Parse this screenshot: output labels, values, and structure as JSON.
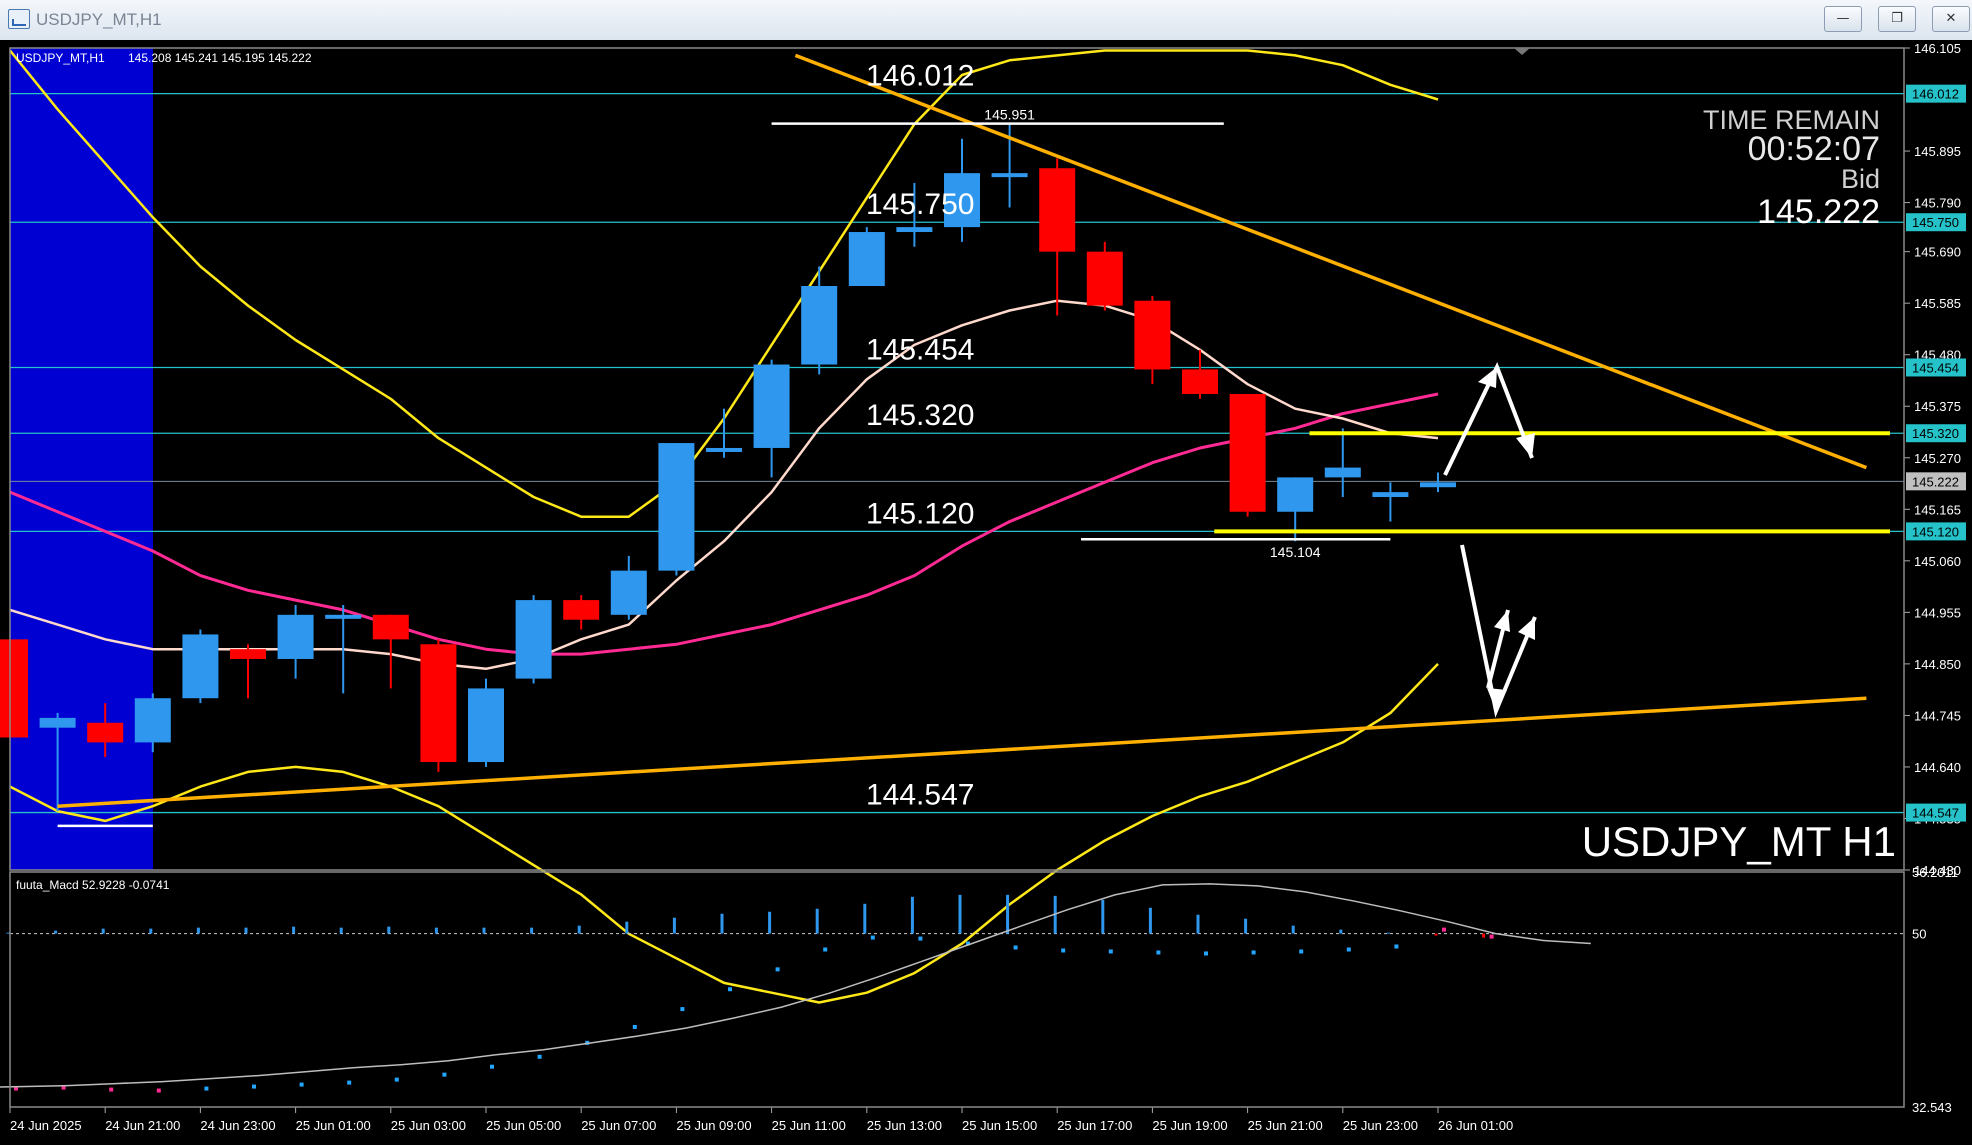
{
  "window": {
    "title": "USDJPY_MT,H1",
    "minimize_icon": "minimize-icon",
    "restore_icon": "restore-icon",
    "close_icon": "close-icon"
  },
  "header": {
    "symbol": "USDJPY_MT,H1",
    "ohlc": "145.208 145.241 145.195 145.222"
  },
  "watermark": "USDJPY_MT H1",
  "info_panel": {
    "time_remain_label": "TIME REMAIN",
    "time_remain": "00:52:07",
    "bid_label": "Bid",
    "bid": "145.222"
  },
  "colors": {
    "bull": "#2f98ee",
    "bear": "#ff0000",
    "level": "#25c3c9",
    "trend": "#ffb000",
    "band": "#ffe818",
    "ma_pink": "#ff2a93",
    "ma_white": "#ffd9cc",
    "session": "#0000d2"
  },
  "chart_data": [
    {
      "type": "candlestick",
      "symbol": "USDJPY_MT",
      "timeframe": "H1",
      "y_ticks": [
        "146.105",
        "145.895",
        "145.790",
        "145.690",
        "145.585",
        "145.480",
        "145.375",
        "145.270",
        "145.165",
        "145.060",
        "144.955",
        "144.850",
        "144.745",
        "144.640",
        "144.535",
        "144.430"
      ],
      "ylim": [
        144.43,
        146.105
      ],
      "x_tick_labels": [
        "24 Jun 2025",
        "24 Jun 21:00",
        "24 Jun 23:00",
        "25 Jun 01:00",
        "25 Jun 03:00",
        "25 Jun 05:00",
        "25 Jun 07:00",
        "25 Jun 09:00",
        "25 Jun 11:00",
        "25 Jun 13:00",
        "25 Jun 15:00",
        "25 Jun 17:00",
        "25 Jun 19:00",
        "25 Jun 21:00",
        "25 Jun 23:00",
        "26 Jun 01:00"
      ],
      "candles": [
        {
          "o": 144.9,
          "h": 144.9,
          "l": 144.7,
          "c": 144.7
        },
        {
          "o": 144.72,
          "h": 144.75,
          "l": 144.55,
          "c": 144.74
        },
        {
          "o": 144.73,
          "h": 144.77,
          "l": 144.66,
          "c": 144.69
        },
        {
          "o": 144.69,
          "h": 144.79,
          "l": 144.67,
          "c": 144.78
        },
        {
          "o": 144.78,
          "h": 144.92,
          "l": 144.77,
          "c": 144.91
        },
        {
          "o": 144.88,
          "h": 144.89,
          "l": 144.78,
          "c": 144.86
        },
        {
          "o": 144.86,
          "h": 144.97,
          "l": 144.82,
          "c": 144.95
        },
        {
          "o": 144.95,
          "h": 144.97,
          "l": 144.79,
          "c": 144.95
        },
        {
          "o": 144.95,
          "h": 144.95,
          "l": 144.8,
          "c": 144.9
        },
        {
          "o": 144.89,
          "h": 144.9,
          "l": 144.63,
          "c": 144.65
        },
        {
          "o": 144.65,
          "h": 144.82,
          "l": 144.64,
          "c": 144.8
        },
        {
          "o": 144.82,
          "h": 144.99,
          "l": 144.81,
          "c": 144.98
        },
        {
          "o": 144.98,
          "h": 144.99,
          "l": 144.92,
          "c": 144.94
        },
        {
          "o": 144.95,
          "h": 145.07,
          "l": 144.94,
          "c": 145.04
        },
        {
          "o": 145.04,
          "h": 145.3,
          "l": 145.03,
          "c": 145.3
        },
        {
          "o": 145.29,
          "h": 145.37,
          "l": 145.27,
          "c": 145.29
        },
        {
          "o": 145.29,
          "h": 145.47,
          "l": 145.23,
          "c": 145.46
        },
        {
          "o": 145.46,
          "h": 145.66,
          "l": 145.44,
          "c": 145.62
        },
        {
          "o": 145.62,
          "h": 145.74,
          "l": 145.62,
          "c": 145.73
        },
        {
          "o": 145.73,
          "h": 145.83,
          "l": 145.7,
          "c": 145.74
        },
        {
          "o": 145.74,
          "h": 145.92,
          "l": 145.71,
          "c": 145.85
        },
        {
          "o": 145.85,
          "h": 145.95,
          "l": 145.78,
          "c": 145.85
        },
        {
          "o": 145.86,
          "h": 145.88,
          "l": 145.56,
          "c": 145.69
        },
        {
          "o": 145.69,
          "h": 145.71,
          "l": 145.57,
          "c": 145.58
        },
        {
          "o": 145.59,
          "h": 145.6,
          "l": 145.42,
          "c": 145.45
        },
        {
          "o": 145.45,
          "h": 145.49,
          "l": 145.39,
          "c": 145.4
        },
        {
          "o": 145.4,
          "h": 145.4,
          "l": 145.15,
          "c": 145.16
        },
        {
          "o": 145.16,
          "h": 145.23,
          "l": 145.1,
          "c": 145.23
        },
        {
          "o": 145.23,
          "h": 145.33,
          "l": 145.19,
          "c": 145.25
        },
        {
          "o": 145.19,
          "h": 145.22,
          "l": 145.14,
          "c": 145.2
        },
        {
          "o": 145.21,
          "h": 145.24,
          "l": 145.2,
          "c": 145.22
        }
      ],
      "horizontal_levels": [
        "146.012",
        "145.750",
        "145.454",
        "145.320",
        "145.120",
        "144.547"
      ],
      "current_price": "145.222",
      "annotations": [
        {
          "text": "145.951",
          "price": 145.951
        },
        {
          "text": "145.104",
          "price": 145.104
        }
      ],
      "ma_white": [
        144.96,
        144.93,
        144.9,
        144.88,
        144.88,
        144.88,
        144.88,
        144.88,
        144.87,
        144.85,
        144.84,
        144.86,
        144.9,
        144.93,
        145.02,
        145.1,
        145.2,
        145.33,
        145.43,
        145.5,
        145.54,
        145.57,
        145.59,
        145.58,
        145.55,
        145.49,
        145.42,
        145.37,
        145.35,
        145.32,
        145.31
      ],
      "ma_pink": [
        145.2,
        145.16,
        145.12,
        145.08,
        145.03,
        145.0,
        144.98,
        144.96,
        144.93,
        144.9,
        144.88,
        144.87,
        144.87,
        144.88,
        144.89,
        144.91,
        144.93,
        144.96,
        144.99,
        145.03,
        145.09,
        145.14,
        145.18,
        145.22,
        145.26,
        145.29,
        145.31,
        145.33,
        145.36,
        145.38,
        145.4
      ],
      "upper_band": [
        146.1,
        145.98,
        145.87,
        145.76,
        145.66,
        145.58,
        145.51,
        145.45,
        145.39,
        145.31,
        145.25,
        145.19,
        145.15,
        145.15,
        145.22,
        145.35,
        145.5,
        145.65,
        145.8,
        145.95,
        146.05,
        146.08,
        146.09,
        146.1,
        146.1,
        146.1,
        146.1,
        146.09,
        146.07,
        146.03,
        146.0
      ],
      "lower_band": [
        144.6,
        144.55,
        144.53,
        144.56,
        144.6,
        144.63,
        144.64,
        144.63,
        144.6,
        144.56,
        144.5,
        144.44,
        144.38,
        144.3,
        144.25,
        144.2,
        144.18,
        144.16,
        144.18,
        144.22,
        144.28,
        144.36,
        144.43,
        144.49,
        144.54,
        144.58,
        144.61,
        144.65,
        144.69,
        144.75,
        144.85
      ],
      "trendlines": [
        {
          "from": [
            16.5,
            146.09
          ],
          "to": [
            39,
            145.25
          ],
          "name": "falling"
        },
        {
          "from": [
            1,
            144.56
          ],
          "to": [
            39,
            144.78
          ],
          "name": "rising"
        }
      ],
      "yellow_levels": [
        {
          "price": 145.32,
          "from": 27.3
        },
        {
          "price": 145.12,
          "from": 25.3
        }
      ]
    },
    {
      "type": "bar",
      "name": "fuuta_Macd",
      "header": "fuuta_Macd 52.9228 -0.0741",
      "y_ticks": [
        "56.2011",
        "50",
        "32.543"
      ],
      "ylim": [
        32.543,
        56.2011
      ],
      "baseline": 50,
      "values": [
        null,
        null,
        50.1,
        50.3,
        50.5,
        50.5,
        50.6,
        50.6,
        50.7,
        50.6,
        50.7,
        50.6,
        50.6,
        50.6,
        50.8,
        51.2,
        51.6,
        52.0,
        52.2,
        52.5,
        53.0,
        53.7,
        53.9,
        53.9,
        53.8,
        53.4,
        52.6,
        51.9,
        51.5,
        50.8,
        50.4,
        50.1,
        49.8,
        49.6
      ],
      "signal_dots": [
        34.5,
        34.4,
        34.5,
        34.3,
        34.2,
        34.4,
        34.6,
        34.8,
        35.0,
        35.3,
        35.8,
        36.6,
        37.6,
        39.0,
        40.6,
        42.4,
        44.4,
        46.4,
        48.4,
        49.6,
        49.5,
        49.0,
        48.6,
        48.3,
        48.2,
        48.1,
        48.0,
        48.1,
        48.2,
        48.4,
        48.7,
        50.4,
        49.7
      ],
      "signal_line": [
        34.5,
        34.6,
        34.7,
        34.9,
        35.1,
        35.4,
        35.7,
        36.1,
        36.5,
        36.8,
        37.2,
        37.8,
        38.3,
        39.0,
        39.7,
        40.5,
        41.5,
        42.6,
        44.0,
        45.6,
        47.3,
        49.0,
        50.7,
        52.4,
        53.9,
        54.9,
        55.0,
        54.8,
        54.2,
        53.3,
        52.3,
        51.2,
        50.0,
        49.3,
        49.0
      ]
    }
  ]
}
